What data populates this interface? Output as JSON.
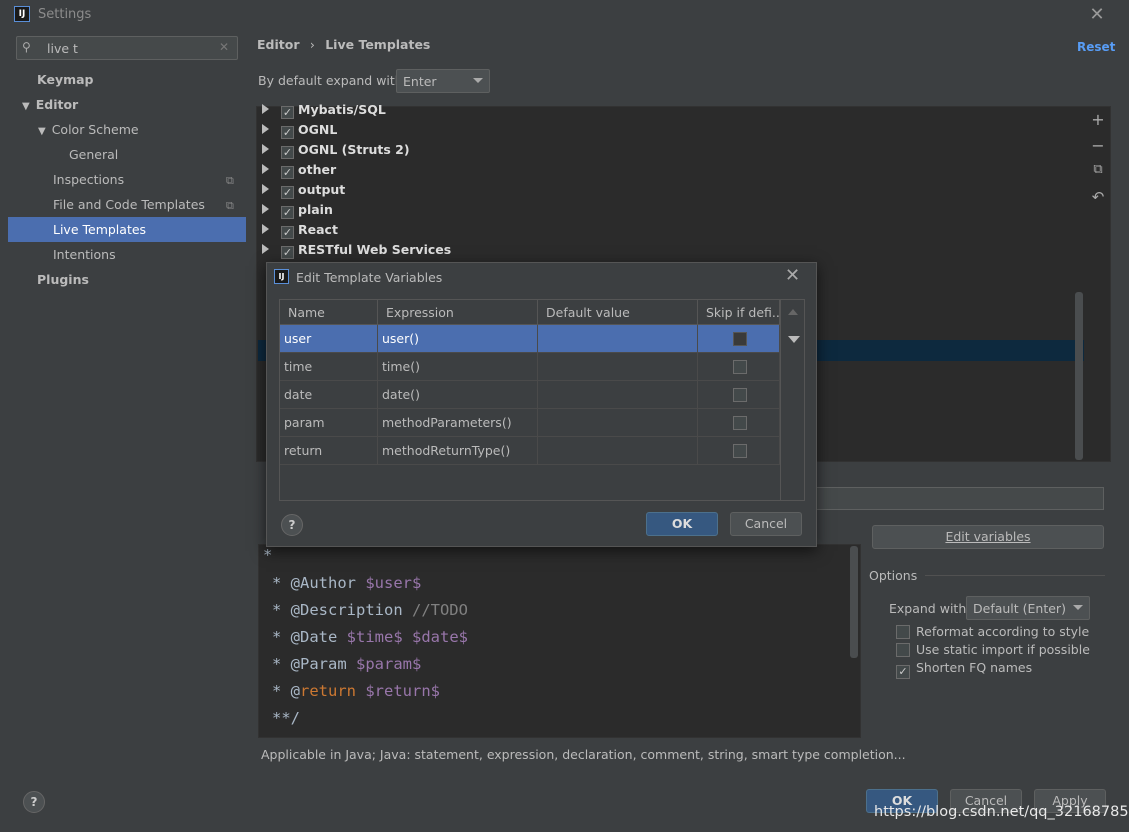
{
  "window": {
    "title": "Settings",
    "icon_text": "IJ"
  },
  "search": {
    "value": "live t"
  },
  "sidebar": {
    "items": [
      {
        "label": "Keymap"
      },
      {
        "label": "Editor"
      },
      {
        "label": "Color Scheme"
      },
      {
        "label": "General"
      },
      {
        "label": "Inspections"
      },
      {
        "label": "File and Code Templates"
      },
      {
        "label": "Live Templates"
      },
      {
        "label": "Intentions"
      },
      {
        "label": "Plugins"
      }
    ]
  },
  "breadcrumb": {
    "part1": "Editor",
    "sep": "›",
    "part2": "Live Templates"
  },
  "reset_label": "Reset",
  "expand": {
    "label": "By default expand with",
    "value": "Enter"
  },
  "groups": [
    {
      "label": "Mybatis/SQL"
    },
    {
      "label": "OGNL"
    },
    {
      "label": "OGNL (Struts 2)"
    },
    {
      "label": "other"
    },
    {
      "label": "output"
    },
    {
      "label": "plain"
    },
    {
      "label": "React"
    },
    {
      "label": "RESTful Web Services"
    }
  ],
  "dialog": {
    "title": "Edit Template Variables",
    "columns": [
      "Name",
      "Expression",
      "Default value",
      "Skip if defi..."
    ],
    "rows": [
      {
        "name": "user",
        "expression": "user()",
        "default": ""
      },
      {
        "name": "time",
        "expression": "time()",
        "default": ""
      },
      {
        "name": "date",
        "expression": "date()",
        "default": ""
      },
      {
        "name": "param",
        "expression": "methodParameters()",
        "default": ""
      },
      {
        "name": "return",
        "expression": "methodReturnType()",
        "default": ""
      }
    ],
    "ok_label": "OK",
    "cancel_label": "Cancel",
    "help_label": "?"
  },
  "template_text": {
    "line0": "*",
    "line1_prefix": "* @Author ",
    "line1_var": "$user$",
    "line2_prefix": "* @Description ",
    "line2_comment": "//TODO",
    "line3_prefix": "* @Date ",
    "line3_var1": "$time$",
    "line3_var2": "$date$",
    "line4_prefix": "* @Param ",
    "line4_var": "$param$",
    "line5_prefix": "* @",
    "line5_kw": "return",
    "line5_var": "$return$",
    "line6": "**/"
  },
  "edit_variables_label": "Edit variables",
  "options": {
    "title": "Options",
    "expand_label": "Expand with",
    "expand_value": "Default (Enter)",
    "reformat": "Reformat according to style",
    "static_import": "Use static import if possible",
    "shorten": "Shorten FQ names"
  },
  "applicable": "Applicable in Java; Java: statement, expression, declaration, comment, string, smart type completion...",
  "footer": {
    "ok": "OK",
    "cancel": "Cancel",
    "apply": "Apply",
    "help": "?"
  },
  "watermark": "https://blog.csdn.net/qq_32168785"
}
